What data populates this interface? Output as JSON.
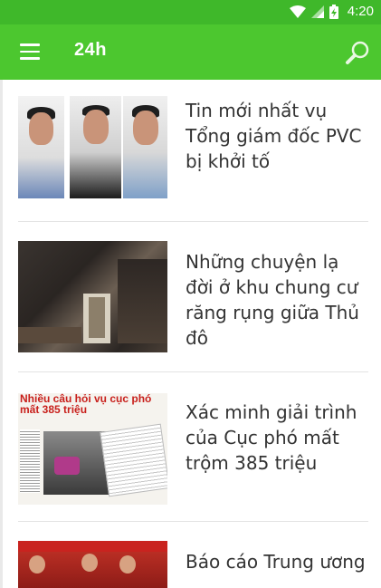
{
  "status_bar": {
    "time": "4:20",
    "icons": [
      "wifi-icon",
      "signal-icon",
      "battery-charging-icon"
    ]
  },
  "app_bar": {
    "title": "24h",
    "menu_icon": "hamburger-menu-icon",
    "search_icon": "search-icon"
  },
  "colors": {
    "status_bar": "#3fb82a",
    "app_bar": "#4cc72f",
    "headline_text": "#333333",
    "divider": "#e3e3e3"
  },
  "articles": [
    {
      "headline": "Tin mới nhất vụ Tổng giám đốc PVC bị khởi tố"
    },
    {
      "headline": "Những chuyện  lạ đời ở khu chung cư  răng rụng  giữa Thủ đô"
    },
    {
      "headline": "Xác minh giải trình của Cục phó mất trộm 385 triệu",
      "thumbnail_text": "Nhiều câu hỏi vụ cục phó mất 385 triệu"
    },
    {
      "headline": "Báo cáo Trung ương"
    }
  ]
}
